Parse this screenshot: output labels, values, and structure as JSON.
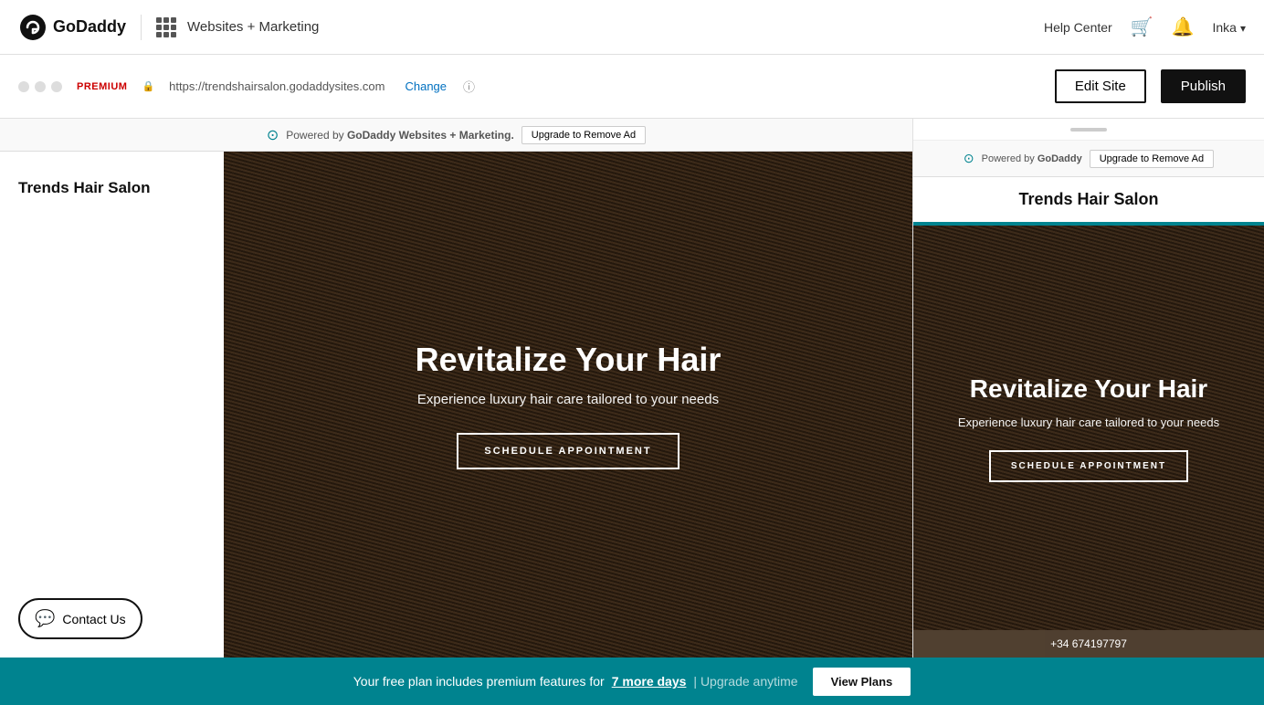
{
  "nav": {
    "logo_text": "GoDaddy",
    "section_title": "Websites + Marketing",
    "help_center": "Help Center",
    "user_name": "Inka"
  },
  "toolbar": {
    "premium_label": "PREMIUM",
    "url": "https://trendshairsalon.godaddysites.com",
    "change_label": "Change",
    "edit_site_label": "Edit Site",
    "publish_label": "Publish"
  },
  "powered_bar": {
    "text": "Powered by",
    "brand": "GoDaddy Websites + Marketing.",
    "upgrade_label": "Upgrade to Remove Ad"
  },
  "desktop_preview": {
    "salon_name": "Trends Hair Salon",
    "contact_us_label": "Contact Us",
    "hero_title": "Revitalize Your Hair",
    "hero_subtitle": "Experience luxury hair care tailored to your needs",
    "schedule_label": "SCHEDULE APPOINTMENT"
  },
  "mobile_preview": {
    "salon_name": "Trends Hair Salon",
    "powered_text": "Powered by",
    "powered_brand": "GoDaddy",
    "upgrade_label": "Upgrade to Remove Ad",
    "hero_title": "Revitalize Your Hair",
    "hero_subtitle": "Experience luxury hair care tailored to your needs",
    "schedule_label": "SCHEDULE APPOINTMENT",
    "phone_number": "+34 674197797"
  },
  "bottom_banner": {
    "text": "Your free plan includes premium features for",
    "days_link": "7 more days",
    "separator": "| Upgrade anytime",
    "view_plans_label": "View Plans"
  }
}
